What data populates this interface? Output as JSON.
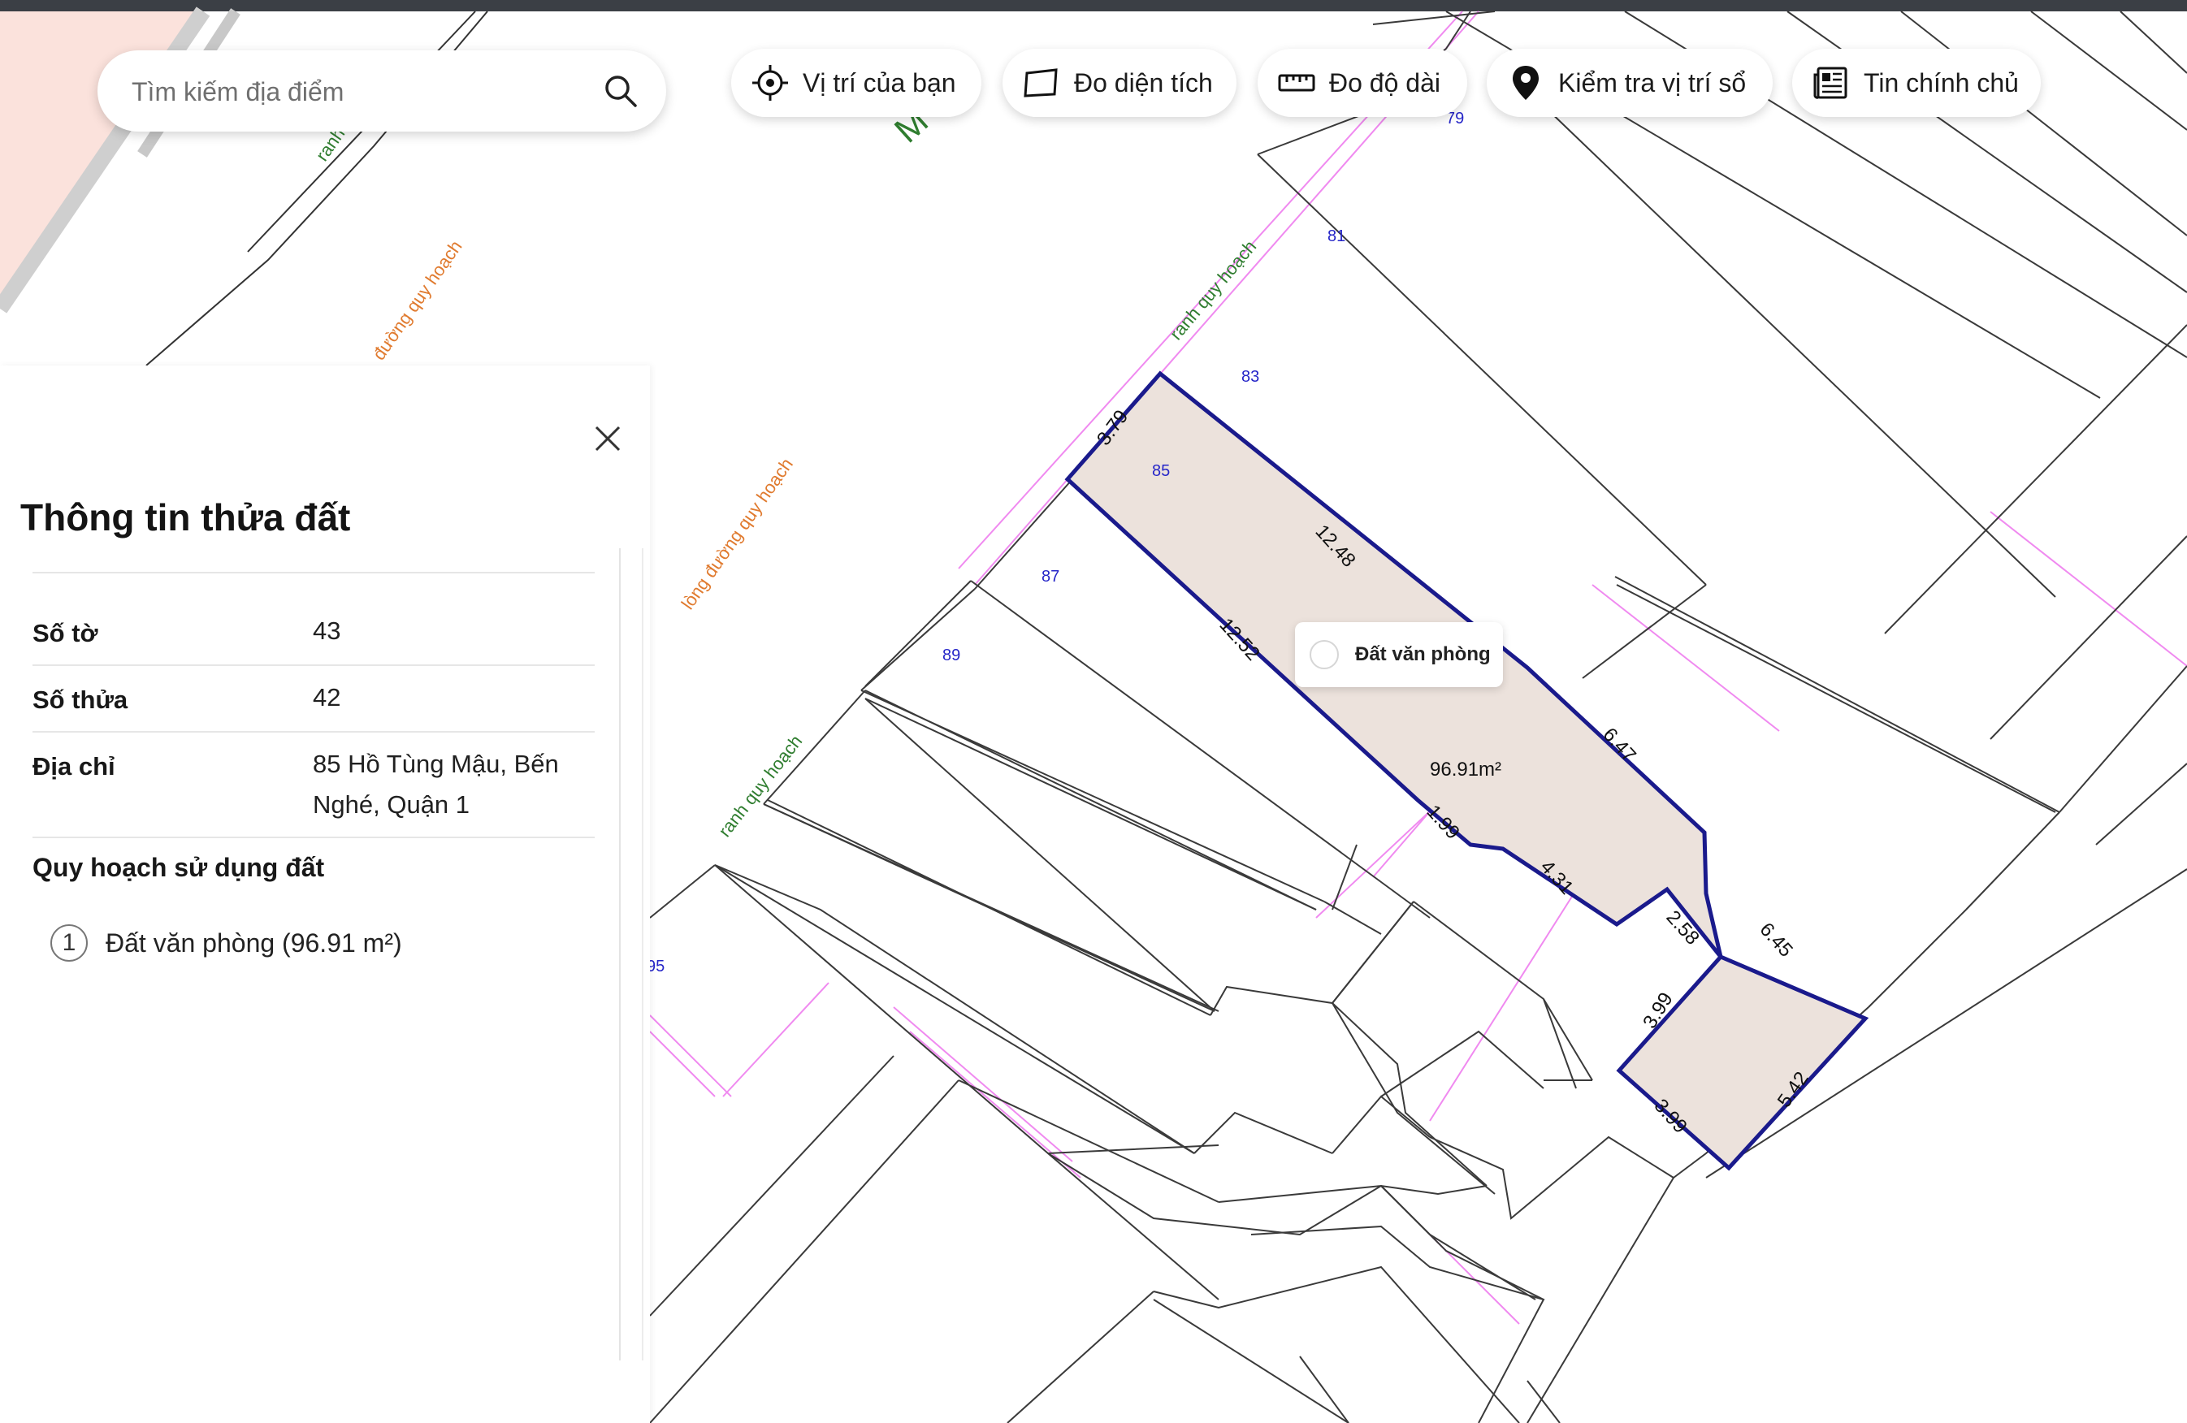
{
  "search": {
    "placeholder": "Tìm kiếm địa điểm"
  },
  "toolbar": [
    {
      "label": "Vị trí của bạn",
      "icon": "crosshair-icon"
    },
    {
      "label": "Đo diện tích",
      "icon": "area-icon"
    },
    {
      "label": "Đo độ dài",
      "icon": "ruler-icon"
    },
    {
      "label": "Kiểm tra vị trí sổ",
      "icon": "location-pin-icon"
    },
    {
      "label": "Tin chính chủ",
      "icon": "newspaper-icon"
    }
  ],
  "panel": {
    "title": "Thông tin thửa đất",
    "rows": [
      {
        "label": "Số tờ",
        "value": "43"
      },
      {
        "label": "Số thửa",
        "value": "42"
      },
      {
        "label": "Địa chỉ",
        "value": "85 Hồ Tùng Mậu, Bến Nghé, Quận 1"
      }
    ],
    "section": "Quy hoạch sử dụng đất",
    "items": [
      {
        "index": "1",
        "text": "Đất văn phòng (96.91 m²)"
      }
    ]
  },
  "map": {
    "tooltip": "Đất văn phòng",
    "area_label": "96.91m²",
    "parcel_numbers": [
      "79",
      "81",
      "83",
      "85",
      "87",
      "89",
      "95"
    ],
    "street_label": "M THỊ",
    "road_labels": [
      "ranh",
      "đường quy hoạch",
      "ranh quy hoạch",
      "lòng đường quy hoạch",
      "ranh quy hoạch"
    ],
    "edge_lengths": [
      "3.79",
      "12.48",
      "12.52",
      "6.47",
      "1.99",
      "4.31",
      "2.58",
      "6.45",
      "3.99",
      "3.99",
      "5.42"
    ]
  },
  "colors": {
    "highlight_fill": "#ece2dc",
    "highlight_stroke": "#1a1a8c",
    "parcel_number": "#2626c8",
    "road_label": "#e07a2e",
    "boundary_label": "#2f7d2f",
    "pink_line": "#f08af0",
    "road_area": "#fbe2dc"
  }
}
